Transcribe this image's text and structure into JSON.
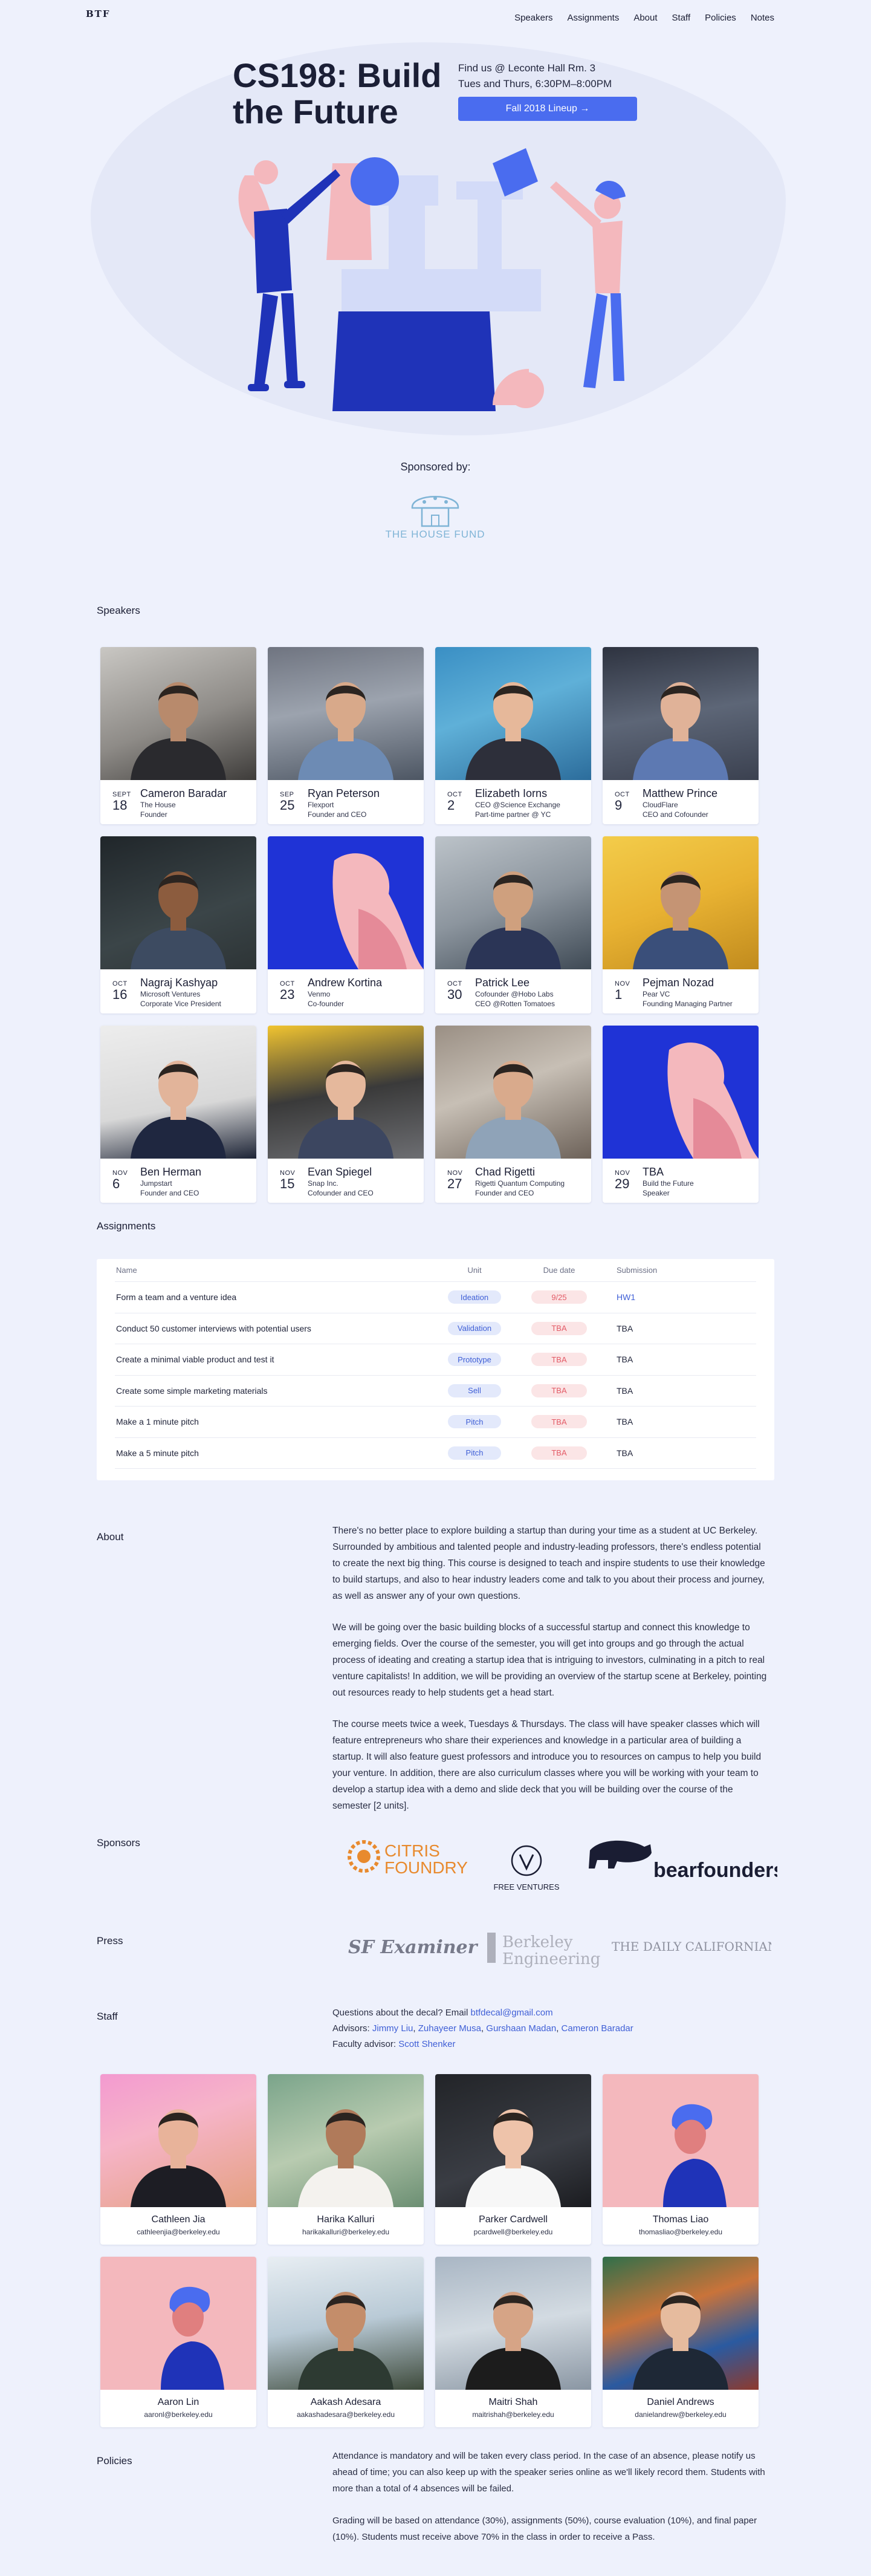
{
  "nav": {
    "logo": "BTF",
    "items": [
      "Speakers",
      "Assignments",
      "About",
      "Staff",
      "Policies",
      "Notes"
    ]
  },
  "hero": {
    "title": "CS198: Build the Future",
    "location": "Find us @ Leconte Hall Rm. 3",
    "time": "Tues and Thurs, 6:30PM–8:00PM",
    "button": "Fall 2018 Lineup →",
    "sponsored_by": "Sponsored by:",
    "sponsor_name": "THE HOUSE FUND"
  },
  "sections": {
    "speakers": "Speakers",
    "assignments": "Assignments",
    "about": "About",
    "sponsors": "Sponsors",
    "press": "Press",
    "staff": "Staff",
    "policies": "Policies"
  },
  "speakers": [
    {
      "month": "SEPT",
      "day": "18",
      "name": "Cameron Baradar",
      "l1": "The House",
      "l2": "Founder",
      "photo": "photo-1"
    },
    {
      "month": "SEP",
      "day": "25",
      "name": "Ryan Peterson",
      "l1": "Flexport",
      "l2": "Founder and CEO",
      "photo": "photo-2"
    },
    {
      "month": "OCT",
      "day": "2",
      "name": "Elizabeth Iorns",
      "l1": "CEO @Science Exchange",
      "l2": "Part-time partner @ YC",
      "photo": "photo-3"
    },
    {
      "month": "OCT",
      "day": "9",
      "name": "Matthew Prince",
      "l1": "CloudFlare",
      "l2": "CEO and Cofounder",
      "photo": "photo-4"
    },
    {
      "month": "OCT",
      "day": "16",
      "name": "Nagraj Kashyap",
      "l1": "Microsoft Ventures",
      "l2": "Corporate Vice President",
      "photo": "photo-5"
    },
    {
      "month": "OCT",
      "day": "23",
      "name": "Andrew Kortina",
      "l1": "Venmo",
      "l2": "Co-founder",
      "photo": "illustration"
    },
    {
      "month": "OCT",
      "day": "30",
      "name": "Patrick Lee",
      "l1": "Cofounder @Hobo Labs",
      "l2": "CEO @Rotten Tomatoes",
      "photo": "photo-7"
    },
    {
      "month": "NOV",
      "day": "1",
      "name": "Pejman Nozad",
      "l1": "Pear VC",
      "l2": "Founding Managing Partner",
      "photo": "photo-8"
    },
    {
      "month": "NOV",
      "day": "6",
      "name": "Ben Herman",
      "l1": "Jumpstart",
      "l2": "Founder and CEO",
      "photo": "photo-9"
    },
    {
      "month": "NOV",
      "day": "15",
      "name": "Evan Spiegel",
      "l1": "Snap Inc.",
      "l2": "Cofounder and CEO",
      "photo": "photo-10"
    },
    {
      "month": "NOV",
      "day": "27",
      "name": "Chad Rigetti",
      "l1": "Rigetti Quantum Computing",
      "l2": "Founder and CEO",
      "photo": "photo-11"
    },
    {
      "month": "NOV",
      "day": "29",
      "name": "TBA",
      "l1": "Build the Future",
      "l2": "Speaker",
      "photo": "illustration"
    }
  ],
  "assignments": {
    "headers": [
      "Name",
      "Unit",
      "Due date",
      "Submission"
    ],
    "rows": [
      {
        "name": "Form a team and a venture idea",
        "unit": "Ideation",
        "due": "9/25",
        "submission": "HW1",
        "link": true
      },
      {
        "name": "Conduct 50 customer interviews with potential users",
        "unit": "Validation",
        "due": "TBA",
        "submission": "TBA",
        "link": false
      },
      {
        "name": "Create a minimal viable product and test it",
        "unit": "Prototype",
        "due": "TBA",
        "submission": "TBA",
        "link": false
      },
      {
        "name": "Create some simple marketing materials",
        "unit": "Sell",
        "due": "TBA",
        "submission": "TBA",
        "link": false
      },
      {
        "name": "Make a 1 minute pitch",
        "unit": "Pitch",
        "due": "TBA",
        "submission": "TBA",
        "link": false
      },
      {
        "name": "Make a 5 minute pitch",
        "unit": "Pitch",
        "due": "TBA",
        "submission": "TBA",
        "link": false
      }
    ]
  },
  "about": [
    "There's no better place to explore building a startup than during your time as a student at UC Berkeley. Surrounded by ambitious and talented people and industry-leading professors, there's endless potential to create the next big thing. This course is designed to teach and inspire students to use their knowledge to build startups, and also to hear industry leaders come and talk to you about their process and journey, as well as answer any of your own questions.",
    "We will be going over the basic building blocks of a successful startup and connect this knowledge to emerging fields. Over the course of the semester, you will get into groups and go through the actual process of ideating and creating a startup idea that is intriguing to investors, culminating in a pitch to real venture capitalists! In addition, we will be providing an overview of the startup scene at Berkeley, pointing out resources ready to help students get a head start.",
    "The course meets twice a week, Tuesdays & Thursdays. The class will have speaker classes which will feature entrepreneurs who share their experiences and knowledge in a particular area of building a startup. It will also feature guest professors and introduce you to resources on campus to help you build your venture. In addition, there are also curriculum classes where you will be working with your team to develop a startup idea with a demo and slide deck that you will be building over the course of the semester [2 units]."
  ],
  "sponsors": {
    "citris_1": "CITRIS",
    "citris_2": "FOUNDRY",
    "free_ventures": "FREE VENTURES",
    "bearfounders": "bearfounders"
  },
  "press": {
    "sf_examiner": "SF Examiner",
    "berkeley_1": "Berkeley",
    "berkeley_2": "Engineering",
    "daily_cal": "THE DAILY CALIFORNIAN"
  },
  "staff_info": {
    "questions_prefix": "Questions about the decal? Email ",
    "email": "btfdecal@gmail.com",
    "advisors_prefix": "Advisors: ",
    "advisors": [
      "Jimmy Liu",
      "Zuhayeer Musa",
      "Gurshaan Madan",
      "Cameron Baradar"
    ],
    "faculty_prefix": "Faculty advisor: ",
    "faculty": "Scott Shenker"
  },
  "staff": [
    {
      "name": "Cathleen Jia",
      "email": "cathleenjia@berkeley.edu"
    },
    {
      "name": "Harika Kalluri",
      "email": "harikakalluri@berkeley.edu"
    },
    {
      "name": "Parker Cardwell",
      "email": "pcardwell@berkeley.edu"
    },
    {
      "name": "Thomas Liao",
      "email": "thomasliao@berkeley.edu"
    },
    {
      "name": "Aaron Lin",
      "email": "aaronl@berkeley.edu"
    },
    {
      "name": "Aakash Adesara",
      "email": "aakashadesara@berkeley.edu"
    },
    {
      "name": "Maitri Shah",
      "email": "maitrishah@berkeley.edu"
    },
    {
      "name": "Daniel Andrews",
      "email": "danielandrew@berkeley.edu"
    }
  ],
  "policies": [
    "Attendance is mandatory and will be taken every class period. In the case of an absence, please notify us ahead of time; you can also keep up with the speaker series online as we'll likely record them. Students with more than a total of 4 absences will be failed.",
    "Grading will be based on attendance (30%), assignments (50%), course evaluation (10%), and final paper (10%). Students must receive above 70% in the class in order to receive a Pass."
  ],
  "colors": {
    "background": "#eef1fc",
    "accent": "#4a6cef",
    "pink": "#f4b8bd",
    "navy": "#1f33b8"
  }
}
